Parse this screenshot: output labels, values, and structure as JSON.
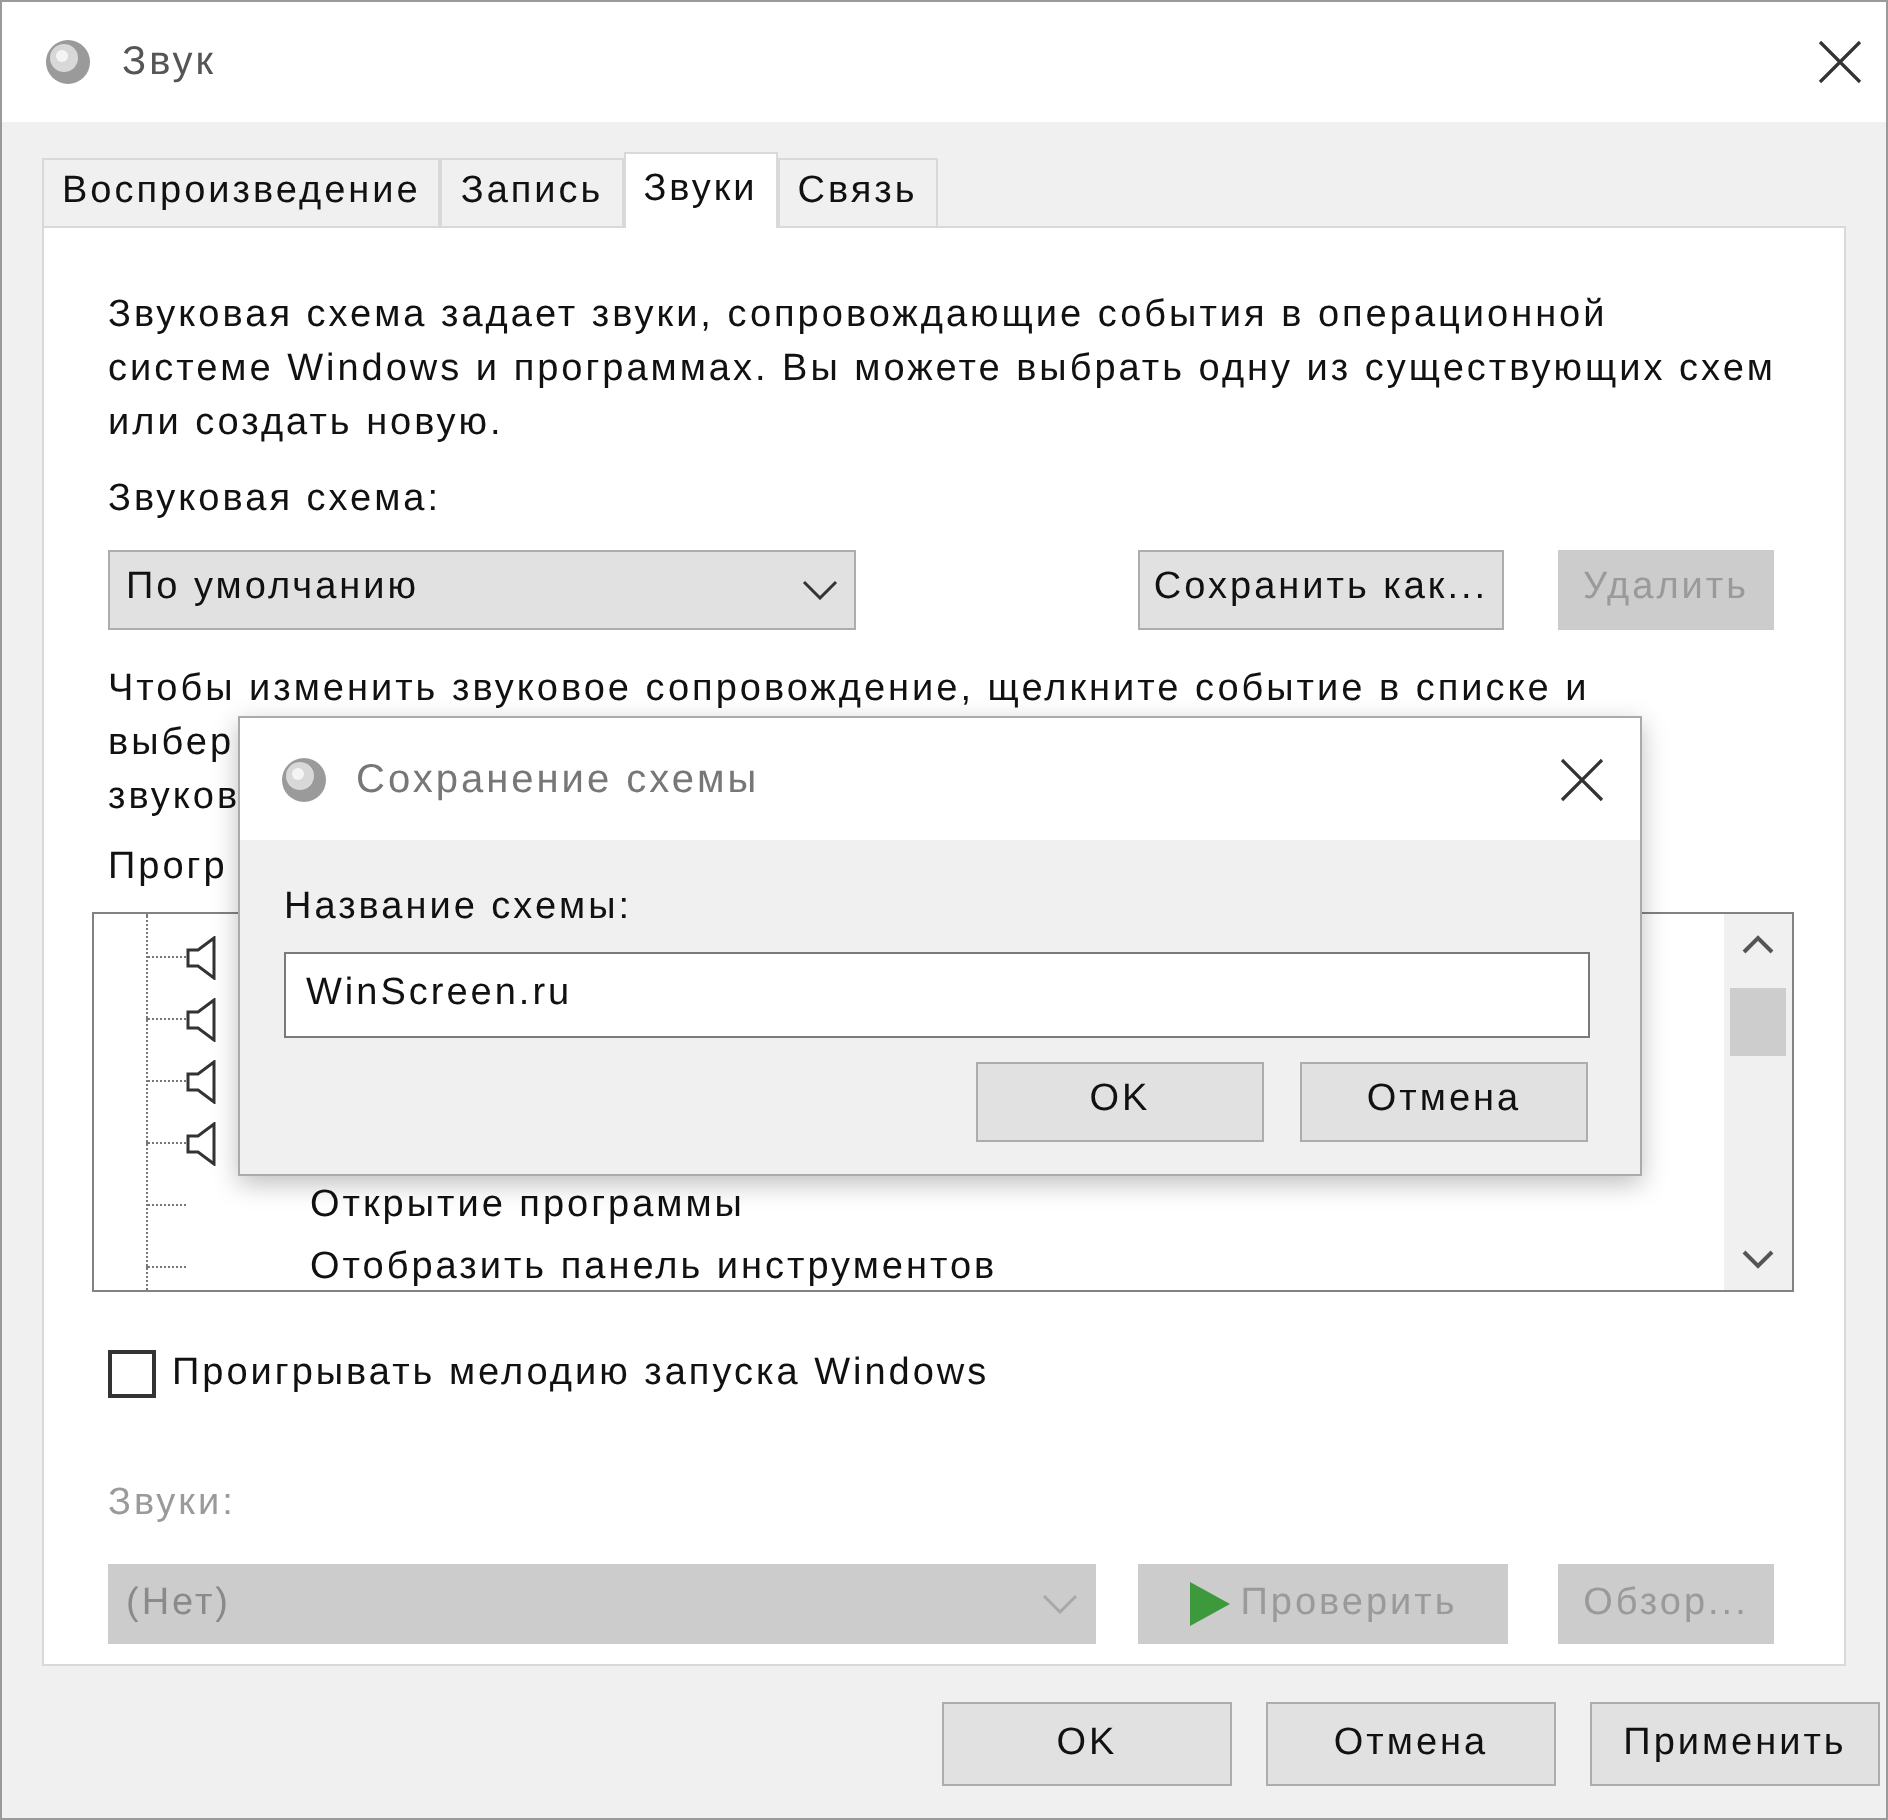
{
  "window": {
    "title": "Звук"
  },
  "tabs": [
    {
      "label": "Воспроизведение",
      "selected": false
    },
    {
      "label": "Запись",
      "selected": false
    },
    {
      "label": "Звуки",
      "selected": true
    },
    {
      "label": "Связь",
      "selected": false
    }
  ],
  "description": "Звуковая схема задает звуки, сопровождающие события в операционной системе Windows и программах. Вы можете выбрать одну из существующих схем или создать новую.",
  "scheme_label": "Звуковая схема:",
  "scheme_select": {
    "value": "По умолчанию",
    "disabled": false
  },
  "scheme_buttons": [
    {
      "label": "Сохранить как...",
      "disabled": false
    },
    {
      "label": "Удалить",
      "disabled": true
    }
  ],
  "hint_lines": [
    "Чтобы изменить звуковое сопровождение, щелкните событие в списке и",
    "выбер",
    "звуков"
  ],
  "events_label": "Прогр",
  "events": [
    {
      "sound": true
    },
    {
      "sound": true
    },
    {
      "sound": true
    },
    {
      "sound": true
    },
    {
      "sound": false,
      "label": "Открытие программы"
    },
    {
      "sound": false,
      "label": "Отобразить панель инструментов"
    }
  ],
  "startup_checkbox": {
    "label": "Проигрывать мелодию запуска Windows",
    "checked": false
  },
  "sounds_label": {
    "text": "Звуки:",
    "disabled": true
  },
  "sounds_select": {
    "value": "(Нет)",
    "disabled": true
  },
  "sound_buttons": [
    {
      "kind": "play",
      "label": "Проверить",
      "disabled": true
    },
    {
      "kind": "plain",
      "label": "Обзор...",
      "disabled": true
    }
  ],
  "footer_buttons": [
    {
      "label": "OK"
    },
    {
      "label": "Отмена"
    },
    {
      "label": "Применить"
    }
  ],
  "save_dialog": {
    "title": "Сохранение схемы",
    "field_label": "Название схемы:",
    "value": "WinScreen.ru",
    "buttons": [
      {
        "label": "OK"
      },
      {
        "label": "Отмена"
      }
    ]
  }
}
